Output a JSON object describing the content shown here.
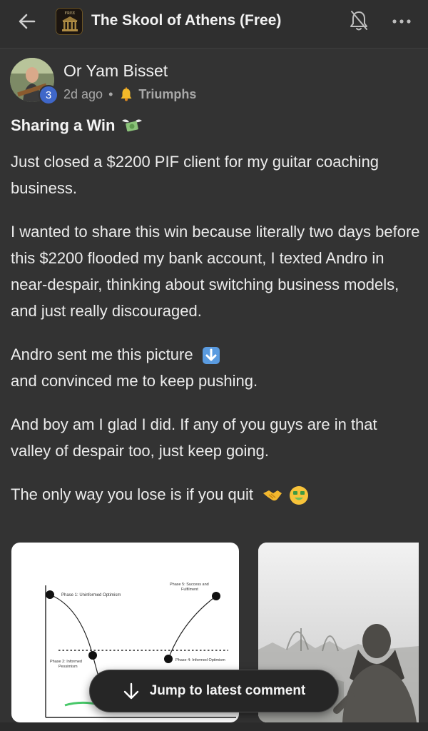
{
  "header": {
    "back_icon": "arrow-left-icon",
    "logo_text": "FREE",
    "group_title": "The Skool of Athens (Free)",
    "bell_icon": "bell-off-icon",
    "more_icon": "more-horizontal-icon"
  },
  "post": {
    "author": "Or Yam Bisset",
    "level": "3",
    "time_ago": "2d ago",
    "separator": "•",
    "category": "Triumphs",
    "category_icon": "bell-icon",
    "title": "Sharing a Win",
    "title_emoji": "money-with-wings-emoji",
    "paragraphs": [
      "Just closed a $2200 PIF client for my guitar coaching business.",
      "I wanted to share this win because literally two days before this $2200 flooded my bank account, I texted Andro in near-despair, thinking about switching business models, and just really discouraged.",
      "Andro sent me this picture",
      "and convinced me to keep pushing.",
      "And boy am I glad I did. If any of you guys are in that valley of despair too, just keep going.",
      "The only way you lose is if you quit"
    ],
    "down_arrow_emoji": "down-arrow-emoji",
    "end_emojis": [
      "handshake-emoji",
      "money-mouth-face-emoji"
    ]
  },
  "attachment_chart": {
    "phase1": "Phase 1: Uninformed Optimism",
    "phase2_line1": "Phase 2: Informed",
    "phase2_line2": "Pessimism",
    "phase4": "Phase 4: Informed Optimism",
    "phase5_line1": "Phase 5: Success and",
    "phase5_line2": "Fulfilment"
  },
  "jump_button": {
    "label": "Jump to latest comment",
    "icon": "arrow-down-icon"
  },
  "colors": {
    "background": "#333333",
    "level_badge": "#3f67c9",
    "muted_text": "#a8a8a8"
  }
}
